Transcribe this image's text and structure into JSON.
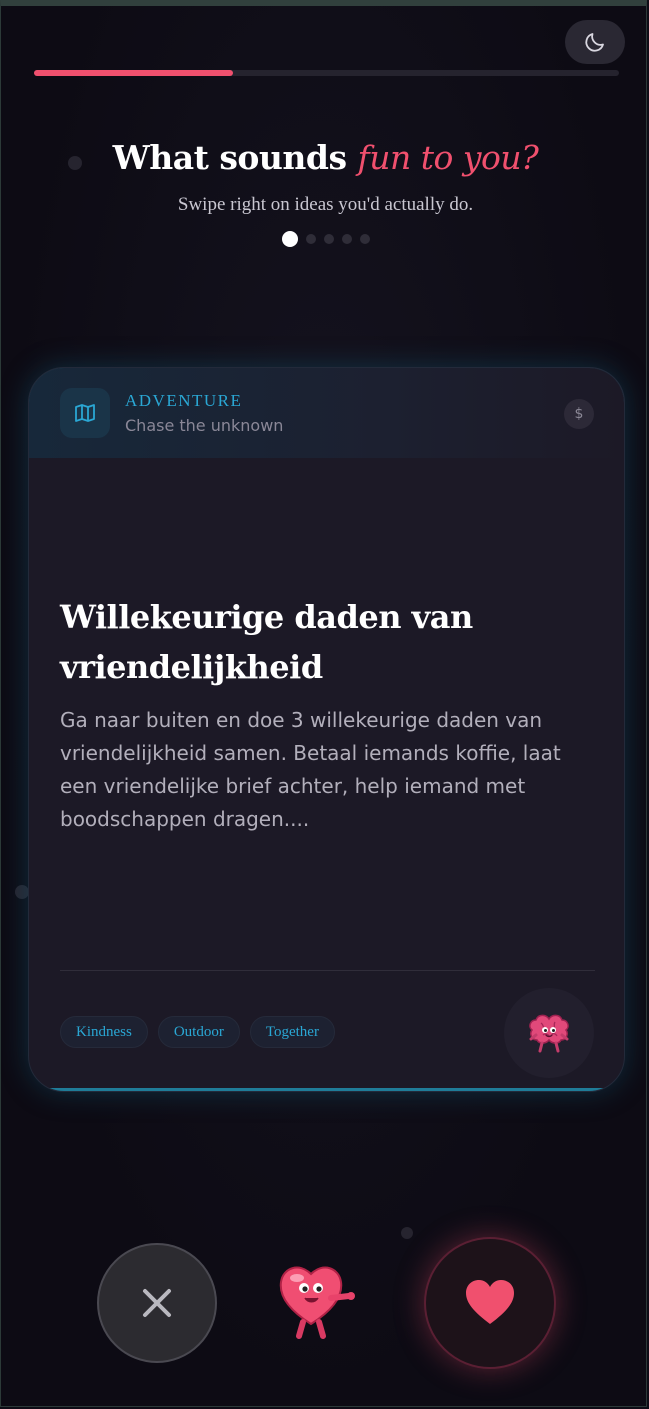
{
  "header": {
    "theme_toggle_icon": "moon-icon",
    "progress_fraction": 0.34
  },
  "intro": {
    "title_plain": "What sounds ",
    "title_accent": "fun to you?",
    "subtitle": "Swipe right on ideas you'd actually do.",
    "page_count": 5,
    "active_page": 0
  },
  "card": {
    "category_icon": "map-icon",
    "category": "ADVENTURE",
    "category_tagline": "Chase the unknown",
    "cost_symbol": "$",
    "title": "Willekeurige daden van vriendelijkheid",
    "description": "Ga naar buiten en doe 3 willekeurige daden van vriendelijkheid samen. Betaal iemands koffie, laat een vriendelijke brief achter, help iemand met boodschappen dragen....",
    "tags": [
      "Kindness",
      "Outdoor",
      "Together"
    ],
    "mascot_icon": "brain-mascot-icon",
    "accent_color": "#2aa7d4"
  },
  "actions": {
    "dislike_icon": "close-icon",
    "like_icon": "heart-icon",
    "mascot_icon": "heart-mascot-icon",
    "like_color": "#f0506e"
  }
}
